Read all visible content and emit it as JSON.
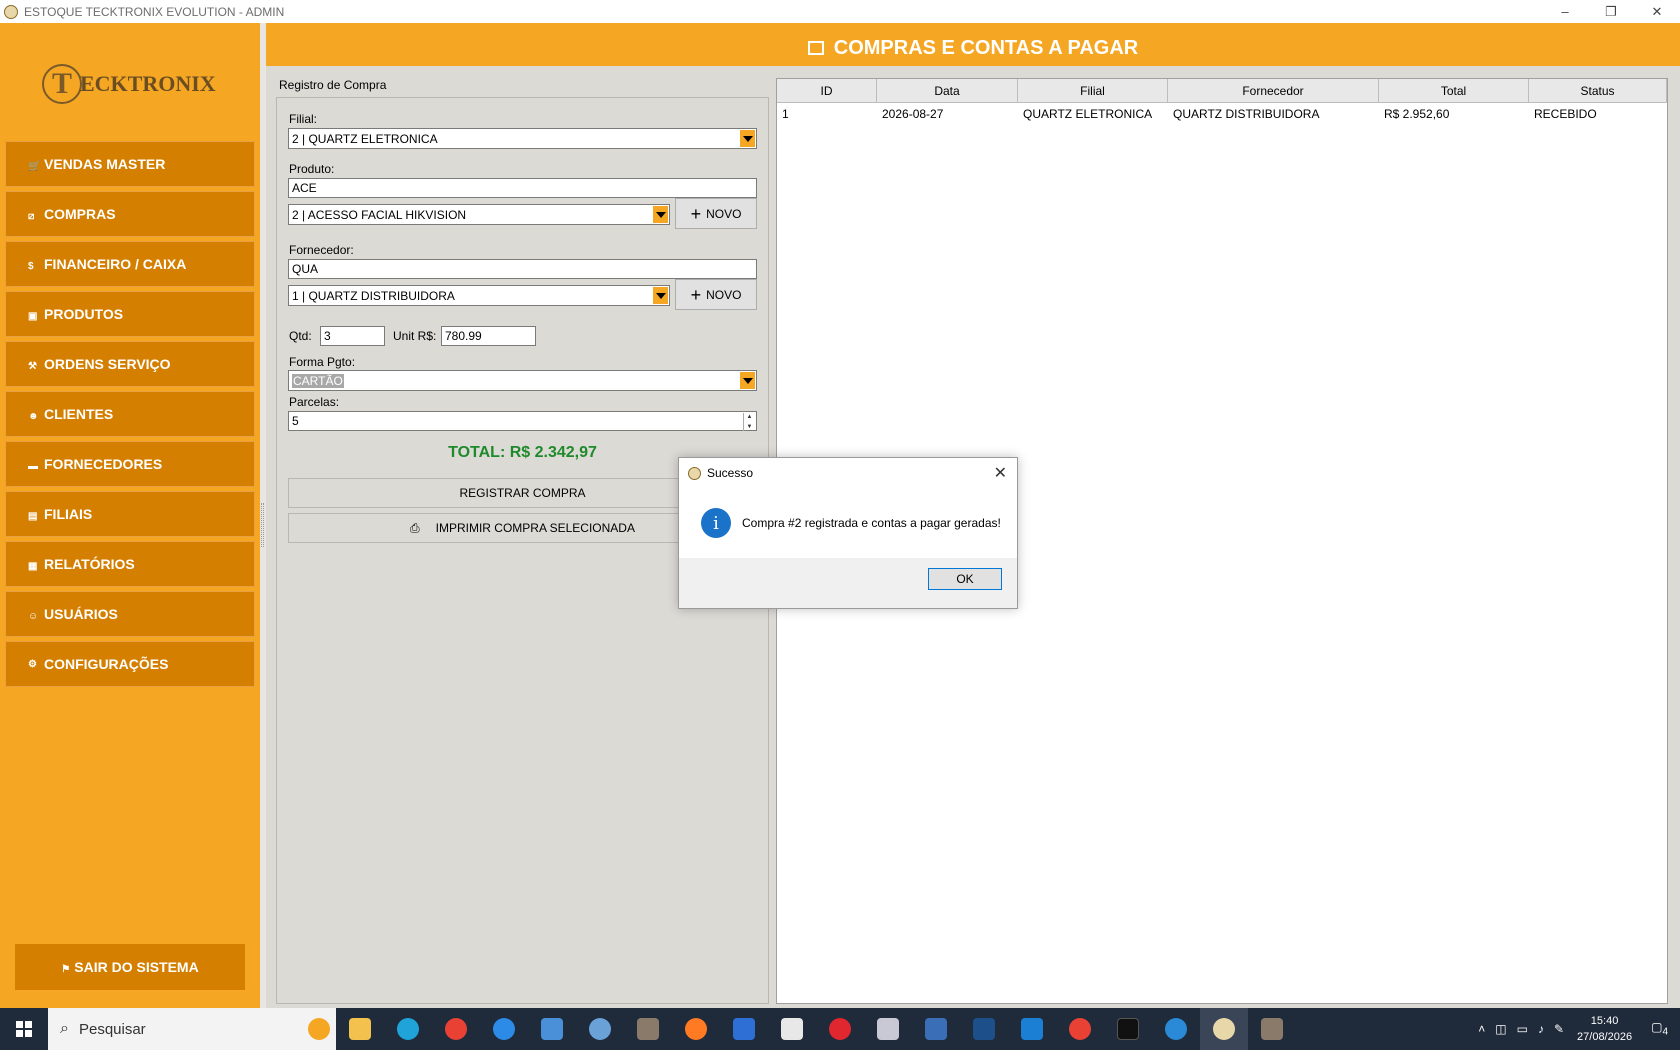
{
  "window": {
    "title": "ESTOQUE TECKTRONIX EVOLUTION - ADMIN",
    "controls": {
      "minimize": "–",
      "restore": "❐",
      "close": "✕"
    }
  },
  "sidebar": {
    "logo": {
      "initial": "T",
      "text": "ECKTRONIX"
    },
    "items": [
      {
        "label": "VENDAS MASTER",
        "icon": "cart-icon"
      },
      {
        "label": "COMPRAS",
        "icon": "box-icon"
      },
      {
        "label": "FINANCEIRO / CAIXA",
        "icon": "money-icon"
      },
      {
        "label": "PRODUTOS",
        "icon": "package-icon"
      },
      {
        "label": "ORDENS SERVIÇO",
        "icon": "wrench-icon"
      },
      {
        "label": "CLIENTES",
        "icon": "people-icon"
      },
      {
        "label": "FORNECEDORES",
        "icon": "truck-icon"
      },
      {
        "label": "FILIAIS",
        "icon": "building-icon"
      },
      {
        "label": "RELATÓRIOS",
        "icon": "chart-icon"
      },
      {
        "label": "USUÁRIOS",
        "icon": "user-icon"
      },
      {
        "label": "CONFIGURAÇÕES",
        "icon": "gear-icon"
      }
    ],
    "logout": "SAIR DO SISTEMA"
  },
  "header": {
    "title": "COMPRAS E CONTAS A PAGAR"
  },
  "form": {
    "group_title": "Registro de Compra",
    "filial_label": "Filial:",
    "filial_value": "2 | QUARTZ ELETRONICA",
    "produto_label": "Produto:",
    "produto_search": "ACE",
    "produto_value": "2 | ACESSO FACIAL HIKVISION",
    "novo_label": "NOVO",
    "fornecedor_label": "Fornecedor:",
    "fornecedor_search": "QUA",
    "fornecedor_value": "1 | QUARTZ DISTRIBUIDORA",
    "qtd_label": "Qtd:",
    "qtd_value": "3",
    "unit_label": "Unit R$:",
    "unit_value": "780.99",
    "forma_label": "Forma Pgto:",
    "forma_value": "CARTÃO",
    "parcelas_label": "Parcelas:",
    "parcelas_value": "5",
    "total": "TOTAL: R$ 2.342,97",
    "register_button": "REGISTRAR COMPRA",
    "print_button": "IMPRIMIR COMPRA SELECIONADA"
  },
  "table": {
    "columns": [
      "ID",
      "Data",
      "Filial",
      "Fornecedor",
      "Total",
      "Status"
    ],
    "rows": [
      [
        "1",
        "2026-08-27",
        "QUARTZ ELETRONICA",
        "QUARTZ DISTRIBUIDORA",
        "R$ 2.952,60",
        "RECEBIDO"
      ]
    ]
  },
  "dialog": {
    "title": "Sucesso",
    "message": "Compra #2 registrada e contas a pagar geradas!",
    "ok": "OK"
  },
  "taskbar": {
    "search_placeholder": "Pesquisar",
    "time": "15:40",
    "date": "27/08/2026",
    "notifications": "4"
  }
}
